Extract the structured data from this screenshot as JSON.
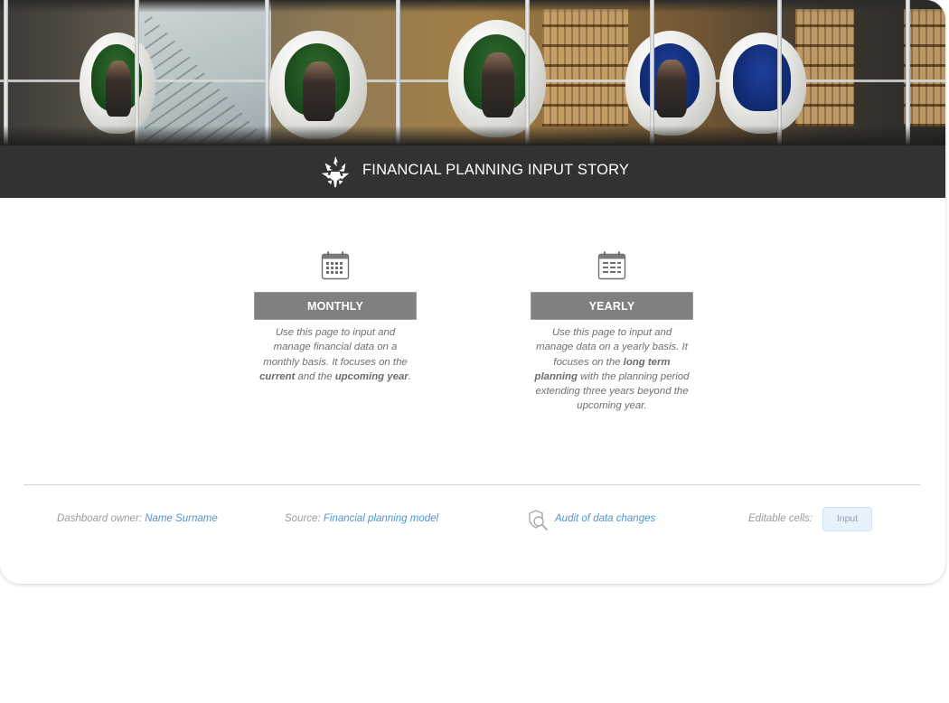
{
  "header": {
    "title": "FINANCIAL PLANNING INPUT STORY",
    "logo_icon": "university-flame-logo-icon",
    "bar_color": "#333232"
  },
  "options": [
    {
      "id": "monthly",
      "icon": "calendar-icon",
      "label": "MONTHLY",
      "description": {
        "pre": "Use this page to input and manage financial data on a monthly basis. It focuses on the ",
        "bold1": "current",
        "mid": " and the ",
        "bold2": "upcoming year",
        "post": "."
      }
    },
    {
      "id": "yearly",
      "icon": "calendar-icon",
      "label": "YEARLY",
      "description": {
        "pre": "Use this page to input and manage data on a yearly basis. It focuses on the ",
        "bold1": "long term planning",
        "post": " with the planning period extending three years beyond the upcoming year."
      }
    }
  ],
  "footer": {
    "owner_label": "Dashboard owner:",
    "owner_name": "Name Surname",
    "source_label": "Source:",
    "source_link": "Financial planning model",
    "audit_icon": "audit-search-icon",
    "audit_link": "Audit of data changes",
    "editable_label": "Editable cells:",
    "editable_chip": "Input"
  },
  "colors": {
    "button_bg": "#807f81",
    "link": "#4f93d6",
    "chip_bg": "#e8f2fc"
  }
}
